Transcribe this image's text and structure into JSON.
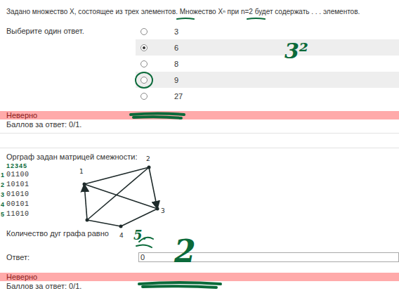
{
  "question1": {
    "text": "Задано множество X, состоящее из трех элементов. Множество Xⁿ при n=2 будет содержать . . . элементов.",
    "instruction": "Выберите один ответ.",
    "options": [
      {
        "label": "3",
        "selected": false,
        "circled": false
      },
      {
        "label": "6",
        "selected": true,
        "circled": false
      },
      {
        "label": "8",
        "selected": false,
        "circled": false
      },
      {
        "label": "9",
        "selected": false,
        "circled": true
      },
      {
        "label": "27",
        "selected": false,
        "circled": false
      }
    ],
    "feedback": "Неверно",
    "score": "Баллов за ответ: 0/1."
  },
  "question2": {
    "text": "Орграф задан матрицей смежности:",
    "matrix": [
      "01100",
      "10101",
      "01010",
      "00101",
      "11010"
    ],
    "prompt": "Количество дуг графа равно",
    "answer_label": "Ответ:",
    "answer_value": "0",
    "feedback": "Неверно",
    "score": "Баллов за ответ: 0/1."
  },
  "graph": {
    "nodes": [
      {
        "label": "1"
      },
      {
        "label": "2"
      },
      {
        "label": "3"
      },
      {
        "label": "4"
      },
      {
        "label": ""
      }
    ],
    "edges": [
      {
        "from": 0,
        "to": 1,
        "arrow": false
      },
      {
        "from": 1,
        "to": 2,
        "arrow": true
      },
      {
        "from": 2,
        "to": 3,
        "arrow": false
      },
      {
        "from": 3,
        "to": 4,
        "arrow": false
      },
      {
        "from": 4,
        "to": 0,
        "arrow": true
      },
      {
        "from": 0,
        "to": 2,
        "arrow": false
      },
      {
        "from": 1,
        "to": 4,
        "arrow": false
      }
    ]
  },
  "annotations": {
    "column_labels": "12345",
    "row_labels": [
      "1",
      "2",
      "3",
      "4",
      "5"
    ],
    "notes": [
      {
        "text": "3²"
      },
      {
        "text": "5."
      },
      {
        "text": "2"
      }
    ]
  }
}
